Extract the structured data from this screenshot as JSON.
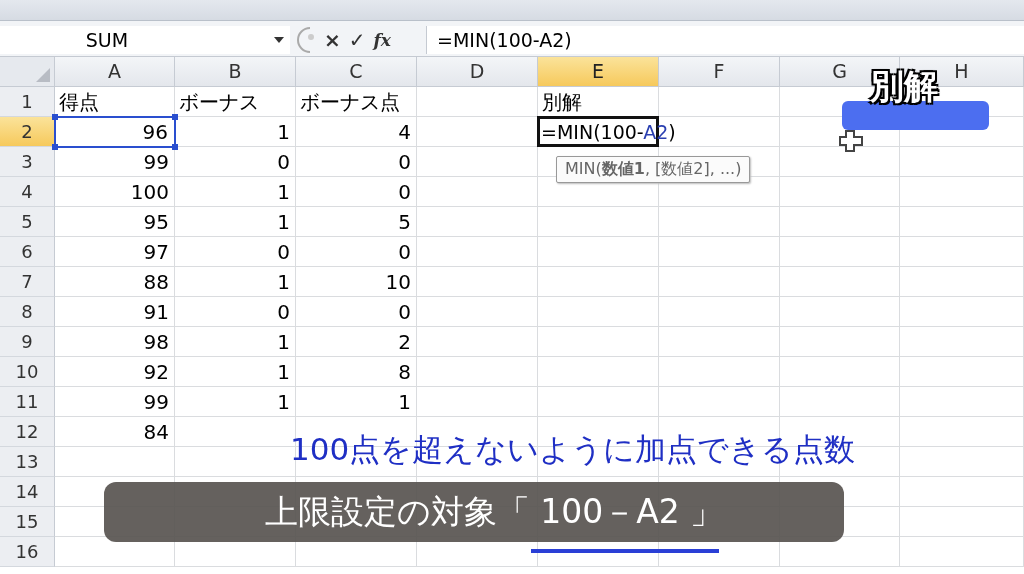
{
  "formula_bar": {
    "name_box": "SUM",
    "cancel": "×",
    "enter": "✓",
    "fx": "fx",
    "formula": "=MIN(100-A2)"
  },
  "columns": [
    {
      "label": "A",
      "selected": false
    },
    {
      "label": "B",
      "selected": false
    },
    {
      "label": "C",
      "selected": false
    },
    {
      "label": "D",
      "selected": false
    },
    {
      "label": "E",
      "selected": true
    },
    {
      "label": "F",
      "selected": false
    },
    {
      "label": "G",
      "selected": false
    },
    {
      "label": "H",
      "selected": false
    }
  ],
  "rows": [
    {
      "label": "1",
      "selected": false,
      "cells": [
        {
          "kind": "text",
          "text": "得点"
        },
        {
          "kind": "text",
          "text": "ボーナス"
        },
        {
          "kind": "text",
          "text": "ボーナス点"
        },
        {
          "kind": "empty"
        },
        {
          "kind": "text",
          "text": "別解"
        }
      ]
    },
    {
      "label": "2",
      "selected": true,
      "cells": [
        {
          "kind": "number",
          "text": "96",
          "referenced": true
        },
        {
          "kind": "number",
          "text": "1"
        },
        {
          "kind": "number",
          "text": "4"
        },
        {
          "kind": "empty"
        },
        {
          "kind": "editing",
          "parts": [
            {
              "kind": "plain",
              "text": "=MIN(100-"
            },
            {
              "kind": "ref",
              "text": "A2"
            },
            {
              "kind": "plain",
              "text": ")"
            }
          ]
        }
      ]
    },
    {
      "label": "3",
      "selected": false,
      "cells": [
        {
          "kind": "number",
          "text": "99"
        },
        {
          "kind": "number",
          "text": "0"
        },
        {
          "kind": "number",
          "text": "0"
        }
      ]
    },
    {
      "label": "4",
      "selected": false,
      "cells": [
        {
          "kind": "number",
          "text": "100"
        },
        {
          "kind": "number",
          "text": "1"
        },
        {
          "kind": "number",
          "text": "0"
        }
      ]
    },
    {
      "label": "5",
      "selected": false,
      "cells": [
        {
          "kind": "number",
          "text": "95"
        },
        {
          "kind": "number",
          "text": "1"
        },
        {
          "kind": "number",
          "text": "5"
        }
      ]
    },
    {
      "label": "6",
      "selected": false,
      "cells": [
        {
          "kind": "number",
          "text": "97"
        },
        {
          "kind": "number",
          "text": "0"
        },
        {
          "kind": "number",
          "text": "0"
        }
      ]
    },
    {
      "label": "7",
      "selected": false,
      "cells": [
        {
          "kind": "number",
          "text": "88"
        },
        {
          "kind": "number",
          "text": "1"
        },
        {
          "kind": "number",
          "text": "10"
        }
      ]
    },
    {
      "label": "8",
      "selected": false,
      "cells": [
        {
          "kind": "number",
          "text": "91"
        },
        {
          "kind": "number",
          "text": "0"
        },
        {
          "kind": "number",
          "text": "0"
        }
      ]
    },
    {
      "label": "9",
      "selected": false,
      "cells": [
        {
          "kind": "number",
          "text": "98"
        },
        {
          "kind": "number",
          "text": "1"
        },
        {
          "kind": "number",
          "text": "2"
        }
      ]
    },
    {
      "label": "10",
      "selected": false,
      "cells": [
        {
          "kind": "number",
          "text": "92"
        },
        {
          "kind": "number",
          "text": "1"
        },
        {
          "kind": "number",
          "text": "8"
        }
      ]
    },
    {
      "label": "11",
      "selected": false,
      "cells": [
        {
          "kind": "number",
          "text": "99"
        },
        {
          "kind": "number",
          "text": "1"
        },
        {
          "kind": "number",
          "text": "1"
        }
      ]
    },
    {
      "label": "12",
      "selected": false,
      "cells": [
        {
          "kind": "number",
          "text": "84"
        }
      ]
    },
    {
      "label": "13",
      "selected": false,
      "cells": []
    },
    {
      "label": "14",
      "selected": false,
      "cells": []
    },
    {
      "label": "15",
      "selected": false,
      "cells": []
    },
    {
      "label": "16",
      "selected": false,
      "cells": []
    }
  ],
  "tooltip": "MIN(**数値1**, [数値2], ...)",
  "overlay": {
    "badge": "別解",
    "subtitle": "100点を超えないように加点できる点数",
    "caption": "上限設定の対象「 100－A2 」"
  }
}
